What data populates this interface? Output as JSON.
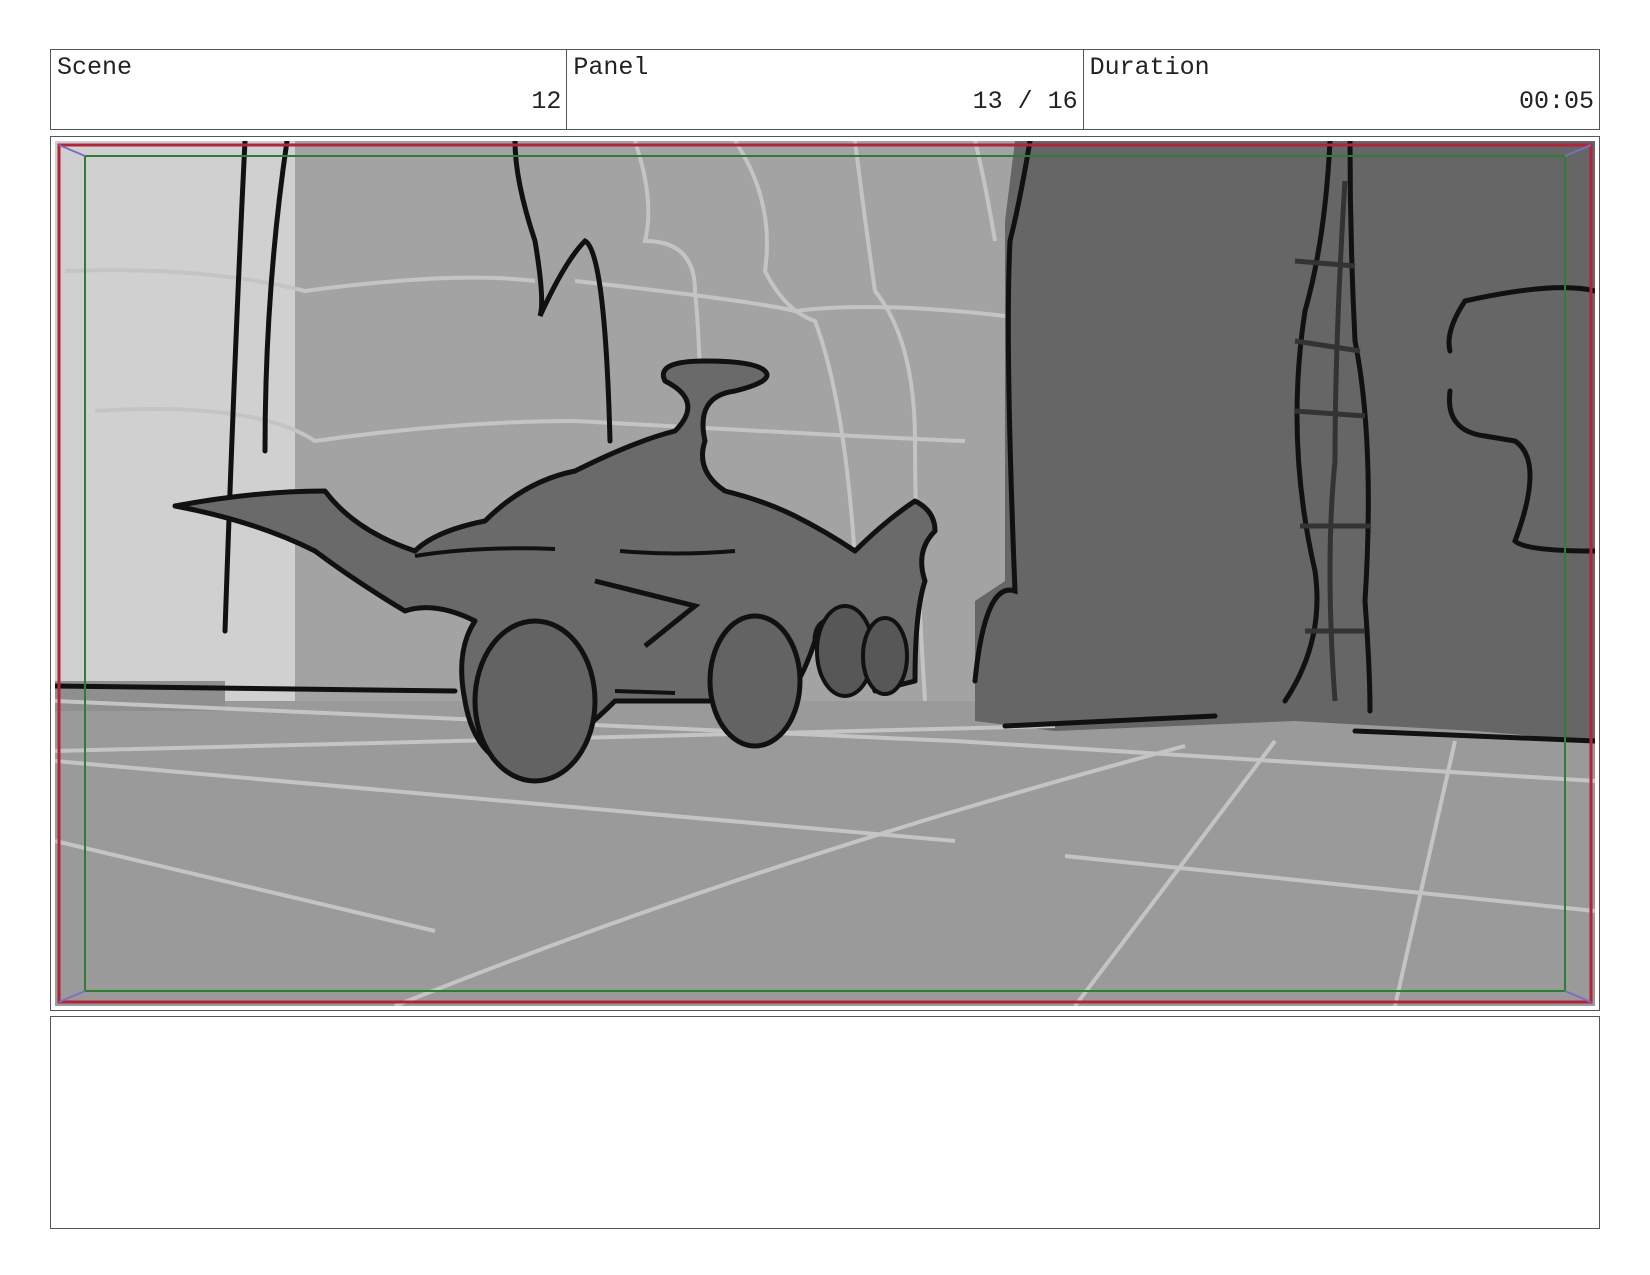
{
  "header": {
    "scene": {
      "label": "Scene",
      "value": "12"
    },
    "panel": {
      "label": "Panel",
      "value": "13 / 16"
    },
    "duration": {
      "label": "Duration",
      "value": "00:05"
    }
  },
  "frame": {
    "subject": "sketch of a creature riding a wheeled vehicle through a tiled corridor",
    "safe_area_outer_color": "#b2243a",
    "safe_area_inner_color": "#2e7d32",
    "corner_mark_color": "#7b6fc0"
  },
  "notes": {
    "text": ""
  }
}
